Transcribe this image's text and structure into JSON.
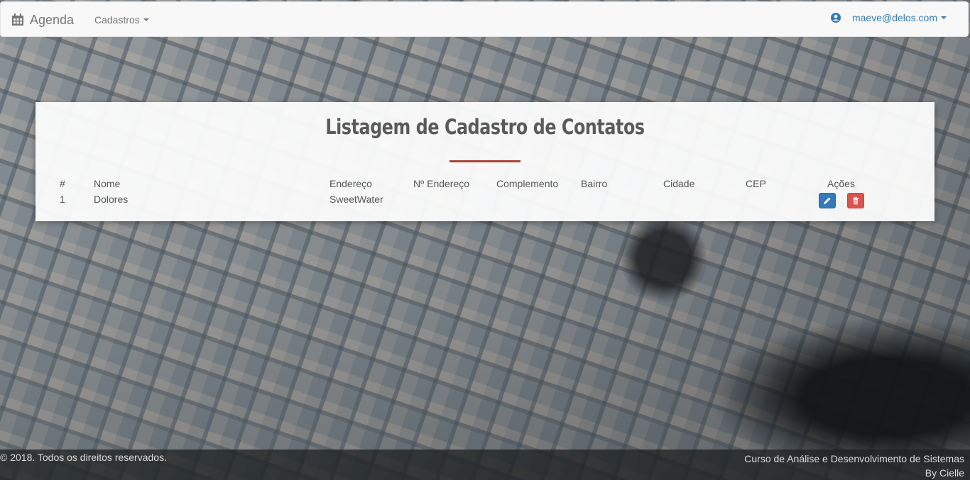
{
  "app": {
    "brand": "Agenda",
    "brand_icon": "calendar-icon"
  },
  "navbar": {
    "menu_label": "Cadastros",
    "user_email": "maeve@delos.com",
    "user_icon": "user-icon"
  },
  "page": {
    "title": "Listagem de Cadastro de Contatos"
  },
  "table": {
    "headers": {
      "id": "#",
      "nome": "Nome",
      "endereco": "Endereço",
      "numero": "Nº Endereço",
      "complemento": "Complemento",
      "bairro": "Bairro",
      "cidade": "Cidade",
      "cep": "CEP",
      "acoes": "Ações"
    },
    "rows": [
      {
        "id": "1",
        "nome": "Dolores",
        "endereco": "SweetWater",
        "numero": "",
        "complemento": "",
        "bairro": "",
        "cidade": "",
        "cep": ""
      }
    ]
  },
  "actions": {
    "edit_icon": "pencil-icon",
    "delete_icon": "trash-icon"
  },
  "footer": {
    "copyright": "© 2018. Todos os direitos reservados.",
    "course": "Curso de Análise e Desenvolvimento de Sistemas",
    "author": "By Cielle"
  },
  "colors": {
    "primary": "#337ab7",
    "danger": "#d9534f",
    "accent_rule": "#a9443a"
  }
}
